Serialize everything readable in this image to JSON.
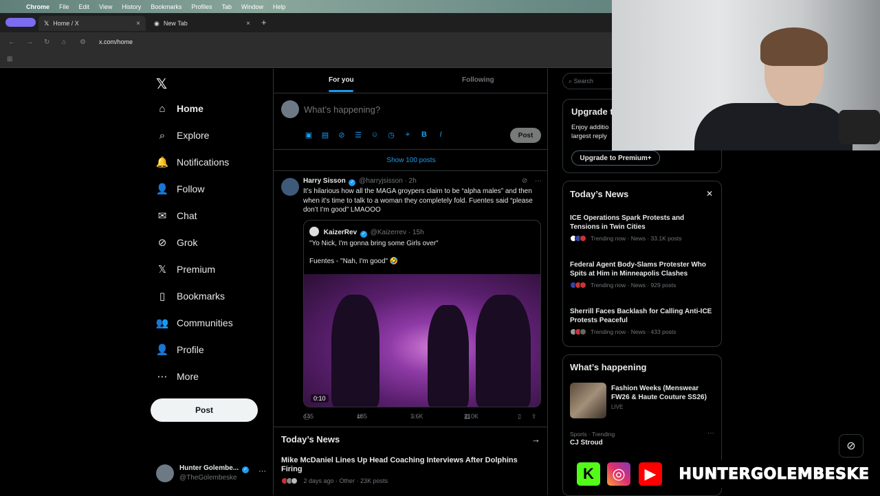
{
  "mac_menu": {
    "apple": "",
    "app": "Chrome",
    "items": [
      "File",
      "Edit",
      "View",
      "History",
      "Bookmarks",
      "Profiles",
      "Tab",
      "Window",
      "Help"
    ]
  },
  "browser": {
    "tabs": [
      {
        "title": "Home / X",
        "close": "×"
      },
      {
        "title": "New Tab",
        "close": "×"
      }
    ],
    "new_tab": "+",
    "url": "x.com/home"
  },
  "nav": {
    "logo": "𝕏",
    "items": [
      {
        "label": "Home",
        "icon": "home-icon",
        "glyph": "⌂"
      },
      {
        "label": "Explore",
        "icon": "search-icon",
        "glyph": "⌕"
      },
      {
        "label": "Notifications",
        "icon": "bell-icon",
        "glyph": "🔔"
      },
      {
        "label": "Follow",
        "icon": "person-add-icon",
        "glyph": "👤"
      },
      {
        "label": "Chat",
        "icon": "mail-icon",
        "glyph": "✉"
      },
      {
        "label": "Grok",
        "icon": "grok-icon",
        "glyph": "⊘"
      },
      {
        "label": "Premium",
        "icon": "x-icon",
        "glyph": "𝕏"
      },
      {
        "label": "Bookmarks",
        "icon": "bookmark-icon",
        "glyph": "▯"
      },
      {
        "label": "Communities",
        "icon": "communities-icon",
        "glyph": "👥"
      },
      {
        "label": "Profile",
        "icon": "profile-icon",
        "glyph": "👤"
      },
      {
        "label": "More",
        "icon": "more-circle-icon",
        "glyph": "⋯"
      }
    ],
    "post_button": "Post",
    "account": {
      "name": "Hunter Golembe...",
      "handle": "@TheGolembeske",
      "more": "···"
    }
  },
  "feed": {
    "tabs": {
      "for_you": "For you",
      "following": "Following"
    },
    "composer": {
      "placeholder": "What’s happening?",
      "post": "Post"
    },
    "show_posts": "Show 100 posts",
    "tweet": {
      "name": "Harry Sisson",
      "handle": "@harryjsisson",
      "time": "· 2h",
      "text": "It’s hilarious how all the MAGA groypers claim to be “alpha males” and then when it’s time to talk to a woman they completely fold. Fuentes said “please don’t I’m good” LMAOOO",
      "quote": {
        "name": "KaizerRev",
        "handle": "@Kaizerrev",
        "time": "· 15h",
        "line1": "\"Yo Nick, I'm gonna bring some Girls over\"",
        "line2": "Fuentes - \"Nah, I'm good\" 🤣",
        "video_time": "0:10"
      },
      "actions": {
        "replies": "445",
        "reposts": "185",
        "likes": "3.6K",
        "views": "210K"
      }
    },
    "news": {
      "title": "Today’s News",
      "arrow": "→",
      "headline": "Mike McDaniel Lines Up Head Coaching Interviews After Dolphins Firing",
      "meta": "2 days ago · Other · 23K posts"
    }
  },
  "sidebar": {
    "search_placeholder": "Search",
    "premium": {
      "title": "Upgrade t",
      "text": "Enjoy additio largest reply",
      "button": "Upgrade to Premium+"
    },
    "today_news": {
      "title": "Today’s News",
      "close": "✕",
      "items": [
        {
          "headline": "ICE Operations Spark Protests and Tensions in Twin Cities",
          "meta": "Trending now · News · 33.1K posts"
        },
        {
          "headline": "Federal Agent Body-Slams Protester Who Spits at Him in Minneapolis Clashes",
          "meta": "Trending now · News · 929 posts"
        },
        {
          "headline": "Sherrill Faces Backlash for Calling Anti-ICE Protests Peaceful",
          "meta": "Trending now · News · 433 posts"
        }
      ]
    },
    "happening": {
      "title": "What’s happening",
      "item_headline": "Fashion Weeks (Menswear FW26 & Haute Couture SS26)",
      "item_status": "LIVE",
      "trend_category": "Sports · Trending",
      "trend_name": "CJ Stroud"
    }
  },
  "overlay": {
    "brand_name": "HUNTERGOLEMBESKE",
    "kick_glyph": "K",
    "ig_glyph": "◎",
    "yt_glyph": "▶"
  },
  "colors": {
    "accent": "#1d9bf0",
    "background": "#000000",
    "text": "#e7e9ea",
    "muted": "#71767b",
    "border": "#2f3336"
  }
}
